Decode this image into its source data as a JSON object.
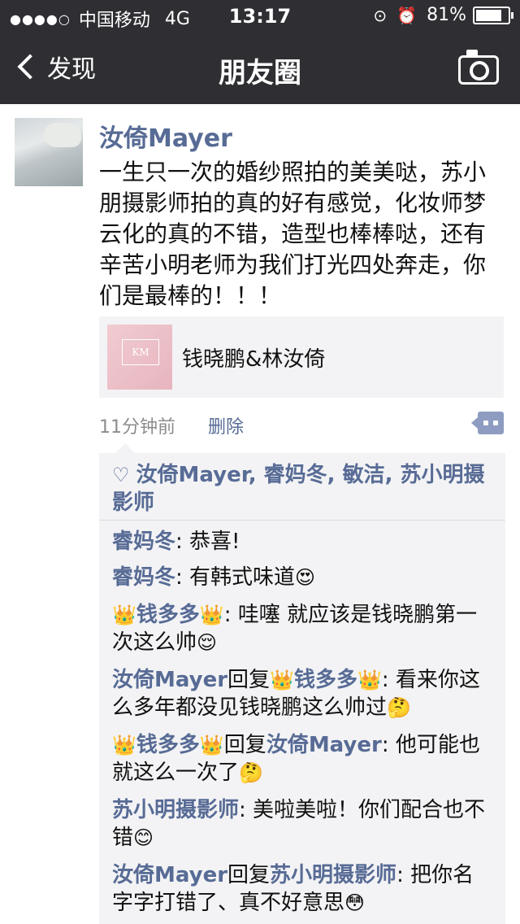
{
  "status_bar": {
    "signal": "●●●●○",
    "carrier": "中国移动",
    "network": "4G",
    "time": "13:17",
    "battery": "81%",
    "battery_level": 0.81
  },
  "nav": {
    "back_label": "发现",
    "title": "朋友圈"
  },
  "post": {
    "author": "汝倚Mayer",
    "text": "一生只一次的婚纱照拍的美美哒，苏小朋摄影师拍的真的好有感觉，化妆师梦云化的真的不错，造型也棒棒哒，还有辛苦小明老师为我们打光四处奔走，你们是最棒的！！！",
    "share": {
      "title": "钱晓鹏&林汝倚",
      "thumb_text": "KM"
    },
    "time_ago": "11分钟前",
    "delete_label": "删除"
  },
  "likes": {
    "names": "汝倚Mayer, 睿妈冬, 敏洁, 苏小明摄影师"
  },
  "comments": [
    {
      "from": "睿妈冬",
      "reply_word": "",
      "to": "",
      "text": ": 恭喜!",
      "emoji": ""
    },
    {
      "from": "睿妈冬",
      "reply_word": "",
      "to": "",
      "text": ": 有韩式味道",
      "emoji": "😍"
    },
    {
      "from": "钱多多",
      "reply_word": "",
      "to": "",
      "text": ": 哇噻 就应该是钱晓鹏第一次这么帅",
      "emoji": "😌"
    },
    {
      "from": "汝倚Mayer",
      "reply_word": "回复",
      "to": "钱多多",
      "text": ": 看来你这么多年都没见钱晓鹏这么帅过",
      "emoji": "🤔"
    },
    {
      "from": "钱多多",
      "reply_word": "回复",
      "to": "汝倚Mayer",
      "text": ": 他可能也就这么一次了",
      "emoji": "🤔"
    },
    {
      "from": "苏小明摄影师",
      "reply_word": "",
      "to": "",
      "text": ": 美啦美啦！你们配合也不错",
      "emoji": "😊"
    },
    {
      "from": "汝倚Mayer",
      "reply_word": "回复",
      "to": "苏小明摄影师",
      "text": ": 把你名字字打错了、真不好意思",
      "emoji": "😳"
    }
  ],
  "crown_glyph": "👑",
  "colors": {
    "nav_bg": "#2e2e33",
    "link": "#576b95",
    "box_bg": "#f3f3f5"
  }
}
